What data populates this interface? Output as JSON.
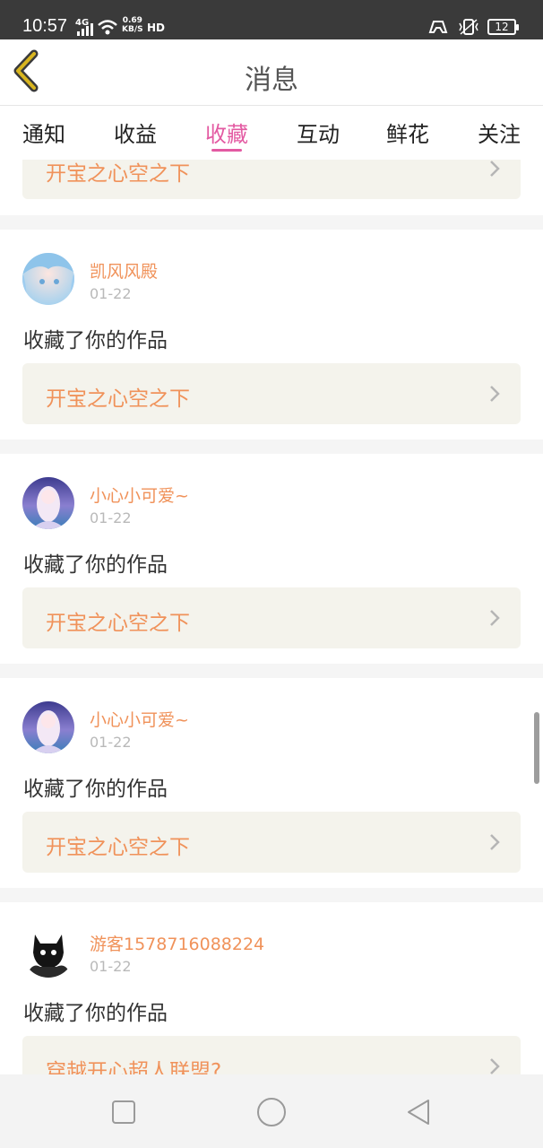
{
  "status_bar": {
    "time": "10:57",
    "network": "4G",
    "speed_value": "0.69",
    "speed_unit": "KB/S",
    "hd": "HD",
    "battery": "12"
  },
  "header": {
    "title": "消息"
  },
  "tabs": [
    {
      "label": "通知"
    },
    {
      "label": "收益"
    },
    {
      "label": "收藏",
      "active": true
    },
    {
      "label": "互动"
    },
    {
      "label": "鲜花"
    },
    {
      "label": "关注"
    }
  ],
  "top_partial_card": {
    "work_title": "开宝之心空之下"
  },
  "items": [
    {
      "user": "凯风风殿",
      "date": "01-22",
      "action": "收藏了你的作品",
      "work_title": "开宝之心空之下"
    },
    {
      "user": "小心小可爱~",
      "date": "01-22",
      "action": "收藏了你的作品",
      "work_title": "开宝之心空之下"
    },
    {
      "user": "小心小可爱~",
      "date": "01-22",
      "action": "收藏了你的作品",
      "work_title": "开宝之心空之下"
    },
    {
      "user": "游客1578716088224",
      "date": "01-22",
      "action": "收藏了你的作品",
      "work_title": "穿越开心超人联盟?"
    }
  ],
  "colors": {
    "accent_pink": "#e35aa2",
    "name_orange": "#f0925a",
    "back_arrow_yellow": "#d8b51f"
  },
  "icons": {
    "back": "back-arrow-icon",
    "chevron": "chevron-right-icon",
    "nav_recent": "square-icon",
    "nav_home": "circle-icon",
    "nav_back": "triangle-back-icon"
  }
}
